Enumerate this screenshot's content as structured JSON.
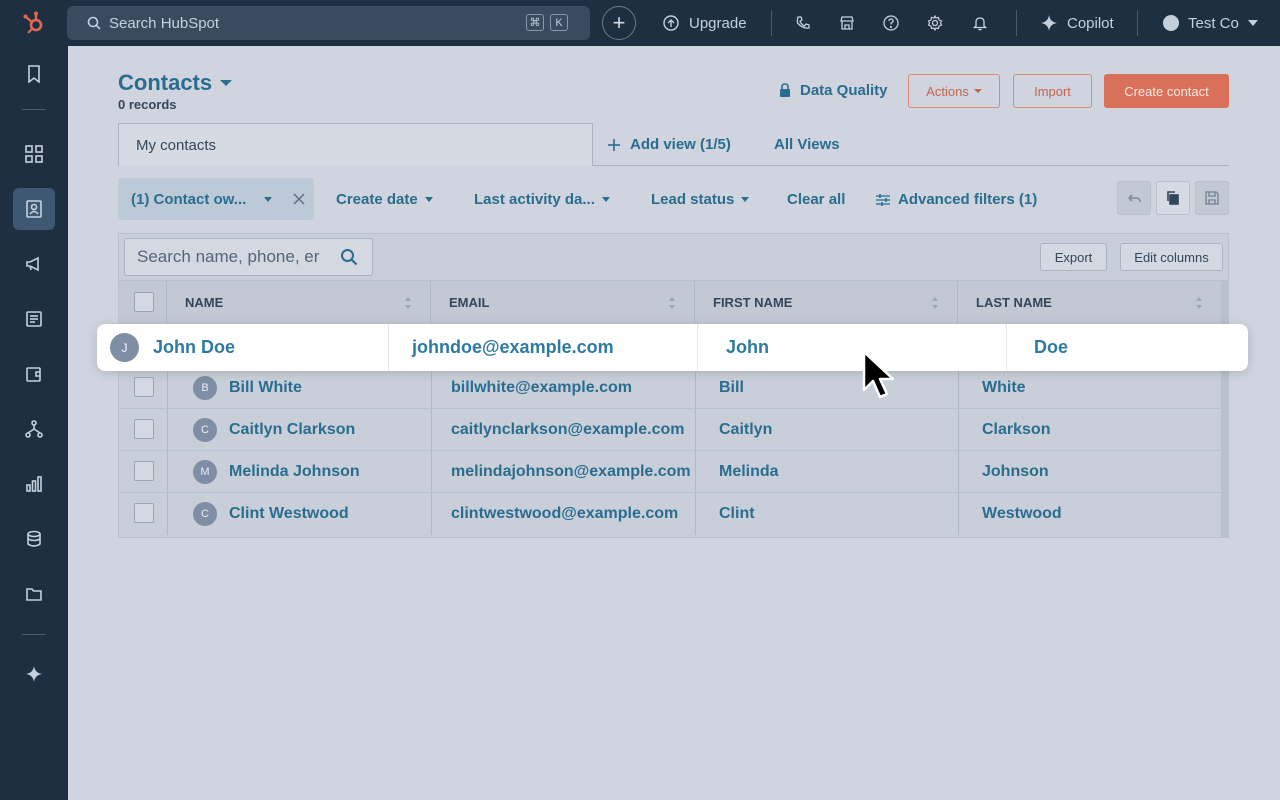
{
  "topnav": {
    "search_placeholder": "Search HubSpot",
    "kbd_cmd": "⌘",
    "kbd_k": "K",
    "upgrade": "Upgrade",
    "copilot": "Copilot",
    "account": "Test Co"
  },
  "header": {
    "title": "Contacts",
    "records": "0 records",
    "data_quality": "Data Quality",
    "actions": "Actions",
    "import": "Import",
    "create_contact": "Create contact"
  },
  "tabs": {
    "active": "My contacts",
    "add_view": "Add view (1/5)",
    "all_views": "All Views"
  },
  "filters": {
    "chip": "(1) Contact ow...",
    "create_date": "Create date",
    "last_activity": "Last activity da...",
    "lead_status": "Lead status",
    "clear_all": "Clear all",
    "advanced": "Advanced filters (1)"
  },
  "table": {
    "search_placeholder": "Search name, phone, er",
    "export": "Export",
    "edit_columns": "Edit columns",
    "columns": [
      "NAME",
      "EMAIL",
      "FIRST NAME",
      "LAST NAME"
    ],
    "rows": [
      {
        "initial": "B",
        "name": "Bill White",
        "email": "billwhite@example.com",
        "first": "Bill",
        "last": "White"
      },
      {
        "initial": "C",
        "name": "Caitlyn Clarkson",
        "email": "caitlynclarkson@example.com",
        "first": "Caitlyn",
        "last": "Clarkson"
      },
      {
        "initial": "M",
        "name": "Melinda Johnson",
        "email": "melindajohnson@example.com",
        "first": "Melinda",
        "last": "Johnson"
      },
      {
        "initial": "C",
        "name": "Clint Westwood",
        "email": "clintwestwood@example.com",
        "first": "Clint",
        "last": "Westwood"
      }
    ]
  },
  "highlight": {
    "initial": "J",
    "name": "John Doe",
    "email": "johndoe@example.com",
    "first": "John",
    "last": "Doe"
  },
  "colors": {
    "nav_bg": "#1f2f42",
    "link": "#2a6d8f",
    "primary": "#d97059",
    "logo": "#e16a4e"
  }
}
